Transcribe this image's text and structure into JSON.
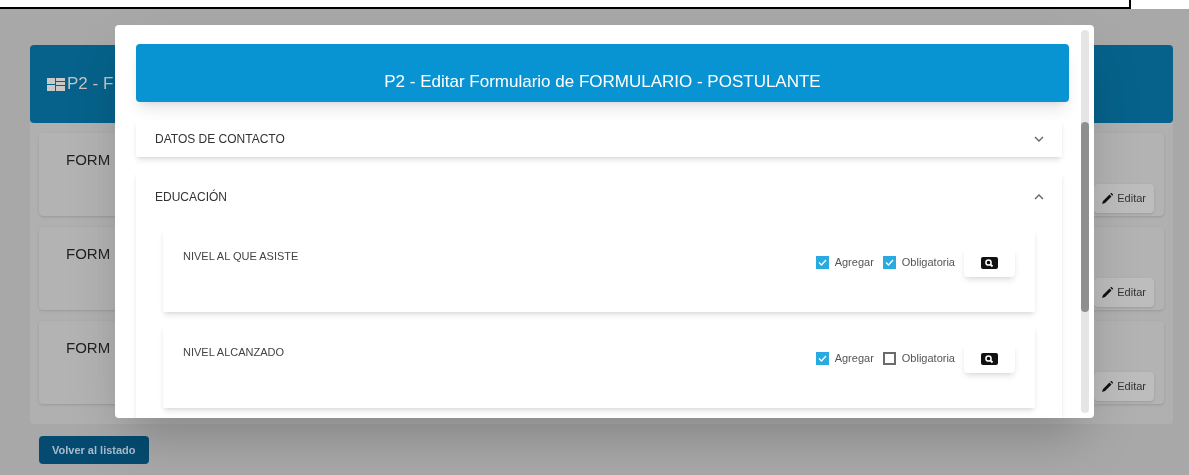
{
  "background_page": {
    "header": {
      "title": "P2 - F"
    },
    "forms": [
      {
        "title": "FORM",
        "button": "Editar"
      },
      {
        "title": "FORM",
        "button": "Editar"
      },
      {
        "title": "FORM",
        "button": "Editar"
      }
    ],
    "back_button": "Volver al listado"
  },
  "modal": {
    "title": "P2 - Editar Formulario de FORMULARIO - POSTULANTE",
    "sections": [
      {
        "title": "DATOS DE CONTACTO",
        "expanded": false
      },
      {
        "title": "EDUCACIÓN",
        "expanded": true,
        "fields": [
          {
            "label": "NIVEL AL QUE ASISTE",
            "add": {
              "label": "Agregar",
              "checked": true
            },
            "required": {
              "label": "Obligatoria",
              "checked": true
            }
          },
          {
            "label": "NIVEL ALCANZADO",
            "add": {
              "label": "Agregar",
              "checked": true
            },
            "required": {
              "label": "Obligatoria",
              "checked": false
            }
          }
        ]
      }
    ]
  }
}
